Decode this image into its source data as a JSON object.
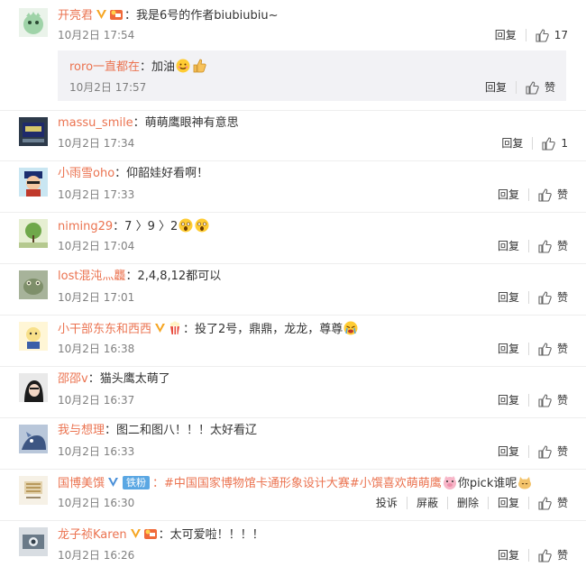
{
  "colors": {
    "username": "#eb7350",
    "text": "#333333",
    "time": "#808080",
    "reply_bg": "#f2f2f5",
    "verified_badge": "#f6a623",
    "fan_badge": "#5aa7e3"
  },
  "labels": {
    "reply": "回复",
    "like": "赞",
    "report": "投诉",
    "block": "屏蔽",
    "delete": "删除"
  },
  "comments": [
    {
      "user": "开亮君",
      "text": "：我是6号的作者biubiubiu~",
      "time": "10月2日 17:54",
      "likes": "17",
      "reply": {
        "user": "roro一直都在",
        "text": "：加油",
        "time": "10月2日 17:57"
      }
    },
    {
      "user": "massu_smile",
      "text": "：萌萌鹰眼神有意思",
      "time": "10月2日 17:34",
      "likes": "1"
    },
    {
      "user": "小雨雪oho",
      "text": "：仰韶娃好看啊！",
      "time": "10月2日 17:33"
    },
    {
      "user": "niming29",
      "text": "：7 〉9 〉2",
      "time": "10月2日 17:04"
    },
    {
      "user": "lost混沌灬龘",
      "text": "：2,4,8,12都可以",
      "time": "10月2日 17:01"
    },
    {
      "user": "小干部东东和西西",
      "text": "：投了2号，鼎鼎，龙龙，尊尊",
      "time": "10月2日 16:38"
    },
    {
      "user": "邵邵v",
      "text": "：猫头鹰太萌了",
      "time": "10月2日 16:37"
    },
    {
      "user": "我与想理",
      "text": "：图二和图八！！！太好看辽",
      "time": "10月2日 16:33"
    },
    {
      "user": "国博美馔",
      "fan_badge": "铁粉",
      "text": "：#中国国家博物馆卡通形象设计大赛#小馔喜欢萌萌鹰",
      "text_tail": "你pick谁呢",
      "time": "10月2日 16:30"
    },
    {
      "user": "龙子祯Karen",
      "text": "：太可爱啦！！！！",
      "time": "10月2日 16:26"
    }
  ]
}
